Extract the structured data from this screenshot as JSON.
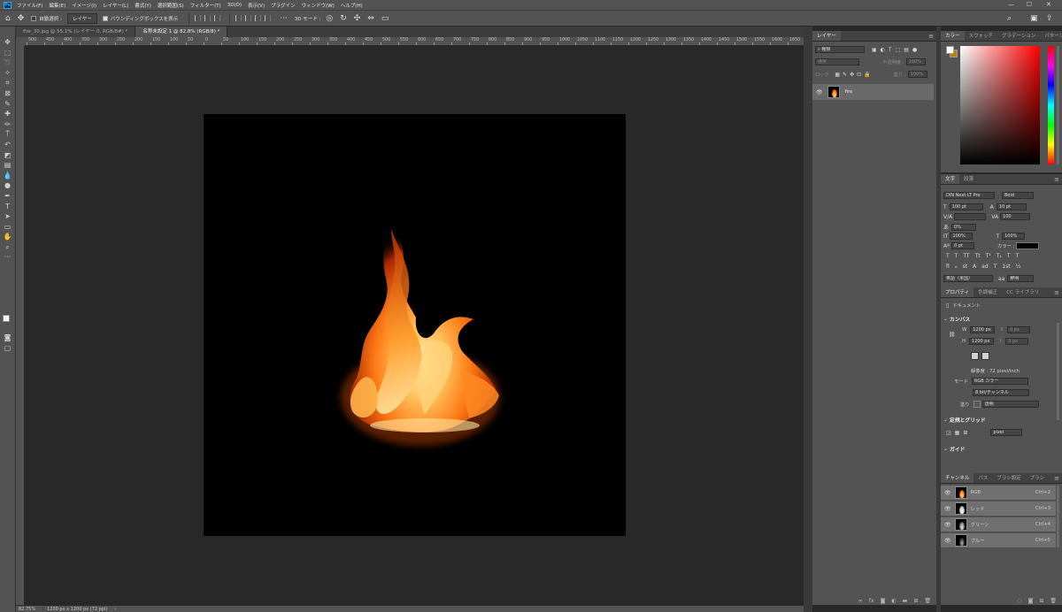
{
  "app": {
    "logo": "Ps"
  },
  "menubar": {
    "items": [
      "ファイル(F)",
      "編集(E)",
      "イメージ(I)",
      "レイヤー(L)",
      "書式(Y)",
      "選択範囲(S)",
      "フィルター(T)",
      "3D(D)",
      "表示(V)",
      "プラグイン",
      "ウィンドウ(W)",
      "ヘルプ(H)"
    ],
    "minimize": "—",
    "maximize": "☐",
    "close": "✕"
  },
  "options_bar": {
    "auto_select_label": "自動選択 :",
    "auto_select_target": "レイヤー",
    "bounding_box_label": "バウンディングボックスを表示",
    "mode_3d_label": "3D モード :"
  },
  "doc_tabs": [
    {
      "label": "fire_30.jpg @ 55.1% (レイヤー 0, RGB/8#) *",
      "active": false
    },
    {
      "label": "名称未設定 1 @ 82.8% (RGB/8) *",
      "active": true
    }
  ],
  "ruler": {
    "ticks": [
      "500",
      "450",
      "400",
      "350",
      "300",
      "250",
      "200",
      "150",
      "100",
      "50",
      "0",
      "50",
      "100",
      "150",
      "200",
      "250",
      "300",
      "350",
      "400",
      "450",
      "500",
      "550",
      "600",
      "650",
      "700",
      "750",
      "800",
      "850",
      "900",
      "950",
      "1000",
      "1050",
      "1100",
      "1150",
      "1200",
      "1250",
      "1300",
      "1350",
      "1400",
      "1450",
      "1500",
      "1550",
      "1600",
      "1650"
    ]
  },
  "status_bar": {
    "zoom": "82.75%",
    "doc_info": "1200 px x 1200 px (72 ppi)",
    "arrow": "›"
  },
  "layers_panel": {
    "tab": "レイヤー",
    "filter": "種類",
    "blend_mode": "通常",
    "opacity_label": "不透明度 :",
    "opacity_value": "100%",
    "lock_label": "ロック :",
    "fill_label": "塗り :",
    "fill_value": "100%",
    "layers": [
      {
        "name": "fire",
        "visible": true
      }
    ]
  },
  "color_panel": {
    "tabs": [
      "カラー",
      "スウォッチ",
      "グラデーション",
      "パターン"
    ]
  },
  "character_panel": {
    "tabs": [
      "文字",
      "段落"
    ],
    "font_family": "DIN Next LT Pro",
    "font_style": "Bold",
    "font_size": "100 pt",
    "leading": "10 pt",
    "tracking": "100",
    "kerning": "",
    "tsume": "0%",
    "vertical_scale": "100%",
    "horizontal_scale": "100%",
    "baseline": "0 pt",
    "color_label": "カラー :",
    "language": "英語（米国）",
    "antialias": "鮮明"
  },
  "properties_panel": {
    "tabs": [
      "プロパティ",
      "色調補正",
      "CC ライブラリ"
    ],
    "doc_label": "ドキュメント",
    "canvas_header": "カンバス",
    "w_label": "W",
    "w_value": "1200 px",
    "h_label": "H",
    "h_value": "1200 px",
    "x_label": "X",
    "y_label": "Y",
    "x_value": "0 px",
    "y_value": "0 px",
    "resolution": "解像度 : 72 pixel/inch",
    "mode_label": "モード",
    "mode_value": "RGB カラー",
    "bit_value": "8 bit/チャンネル",
    "fill_label": "塗り",
    "fill_value": "透明",
    "rulers_header": "定規とグリッド",
    "unit_value": "pixel",
    "guides_header": "ガイド"
  },
  "channels_panel": {
    "tabs": [
      "チャンネル",
      "パス",
      "ブラシ設定",
      "ブラシ"
    ],
    "channels": [
      {
        "name": "RGB",
        "shortcut": "Ctrl+2"
      },
      {
        "name": "レッド",
        "shortcut": "Ctrl+3"
      },
      {
        "name": "グリーン",
        "shortcut": "Ctrl+4"
      },
      {
        "name": "ブルー",
        "shortcut": "Ctrl+5"
      }
    ]
  },
  "colors": {
    "accent_blue": "#31a8ff",
    "foreground": "#ffffff",
    "background": "#c87d0e"
  }
}
